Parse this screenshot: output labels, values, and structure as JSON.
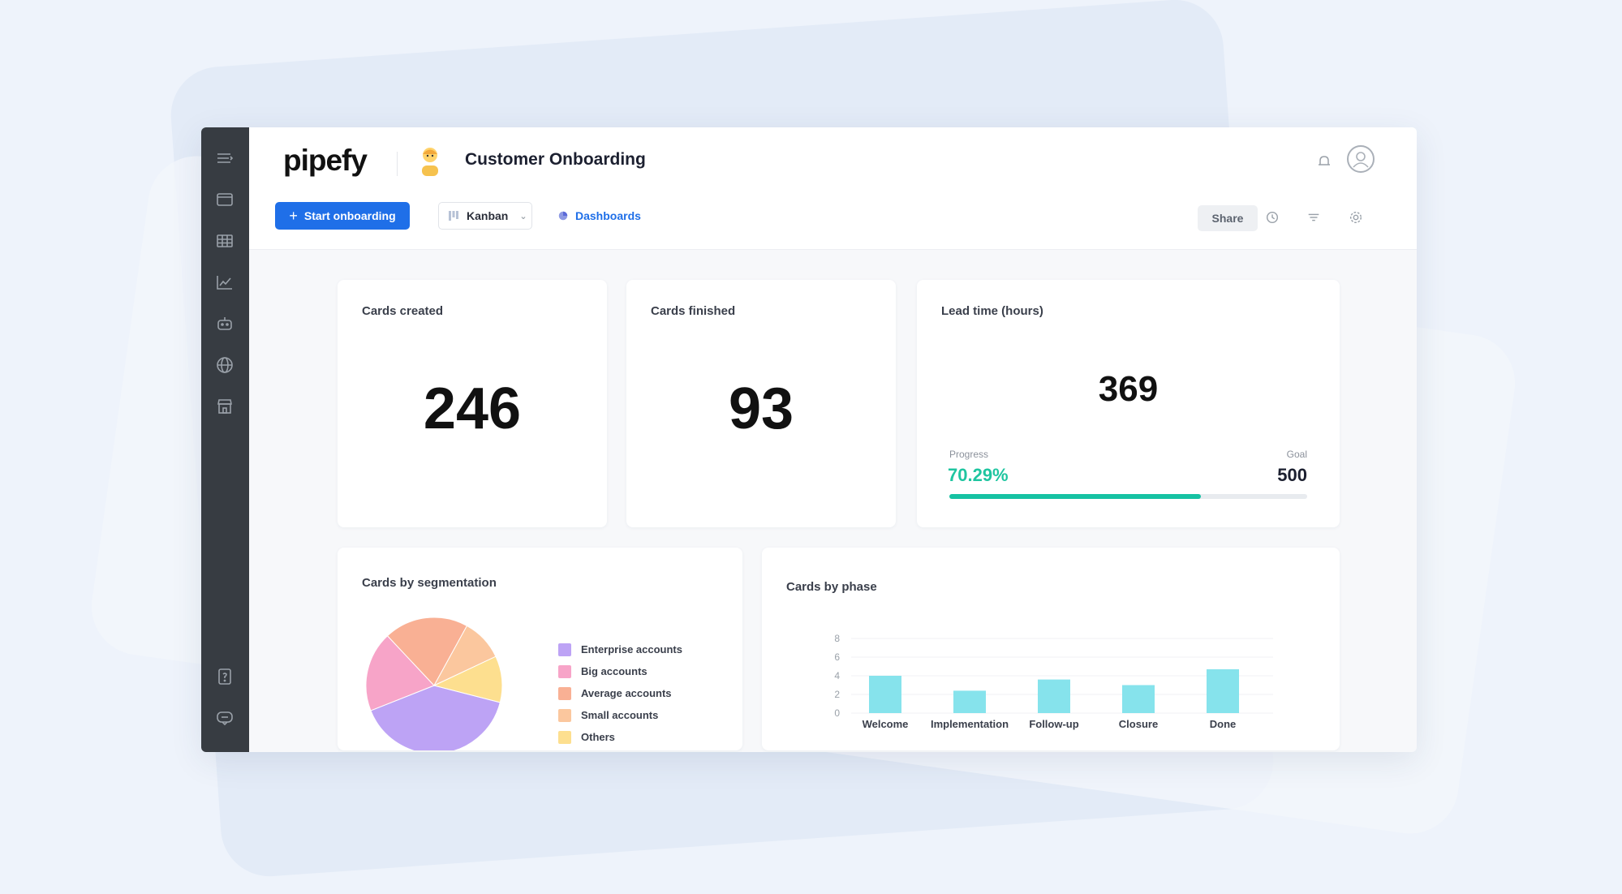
{
  "app": {
    "logo": "pipefy",
    "pipe_title": "Customer Onboarding"
  },
  "toolbar": {
    "start_label": "Start onboarding",
    "view_label": "Kanban",
    "dashboards_label": "Dashboards",
    "share_label": "Share"
  },
  "sidebar": {
    "items": [
      "menu-icon",
      "card-icon",
      "table-icon",
      "chart-icon",
      "robot-icon",
      "globe-icon",
      "store-icon",
      "help-icon",
      "chat-icon"
    ]
  },
  "kpis": {
    "cards_created": {
      "title": "Cards created",
      "value": "246"
    },
    "cards_finished": {
      "title": "Cards finished",
      "value": "93"
    },
    "lead_time": {
      "title": "Lead time (hours)",
      "value": "369",
      "progress_label": "Progress",
      "progress_value": "70.29%",
      "progress_fraction": 0.7029,
      "goal_label": "Goal",
      "goal_value": "500"
    }
  },
  "colors": {
    "primary": "#1f6fe8",
    "progress": "#16c2a3",
    "bar": "#86e3ec",
    "sidebar": "#373c42"
  },
  "chart_data": [
    {
      "type": "pie",
      "title": "Cards by segmentation",
      "categories": [
        "Enterprise accounts",
        "Big accounts",
        "Average  accounts",
        "Small accounts",
        "Others"
      ],
      "values": [
        40,
        19,
        20,
        10,
        11
      ],
      "colors": [
        "#bda3f5",
        "#f7a4c8",
        "#f9b094",
        "#fbc79e",
        "#fddf8f"
      ],
      "legend": "right"
    },
    {
      "type": "bar",
      "title": "Cards by phase",
      "categories": [
        "Welcome",
        "Implementation",
        "Follow-up",
        "Closure",
        "Done"
      ],
      "values": [
        4,
        2.4,
        3.6,
        3,
        4.7
      ],
      "yticks": [
        "0",
        "2",
        "4",
        "6",
        "8"
      ],
      "ylim": [
        0,
        8
      ],
      "grid": true,
      "color": "#86e3ec"
    }
  ]
}
